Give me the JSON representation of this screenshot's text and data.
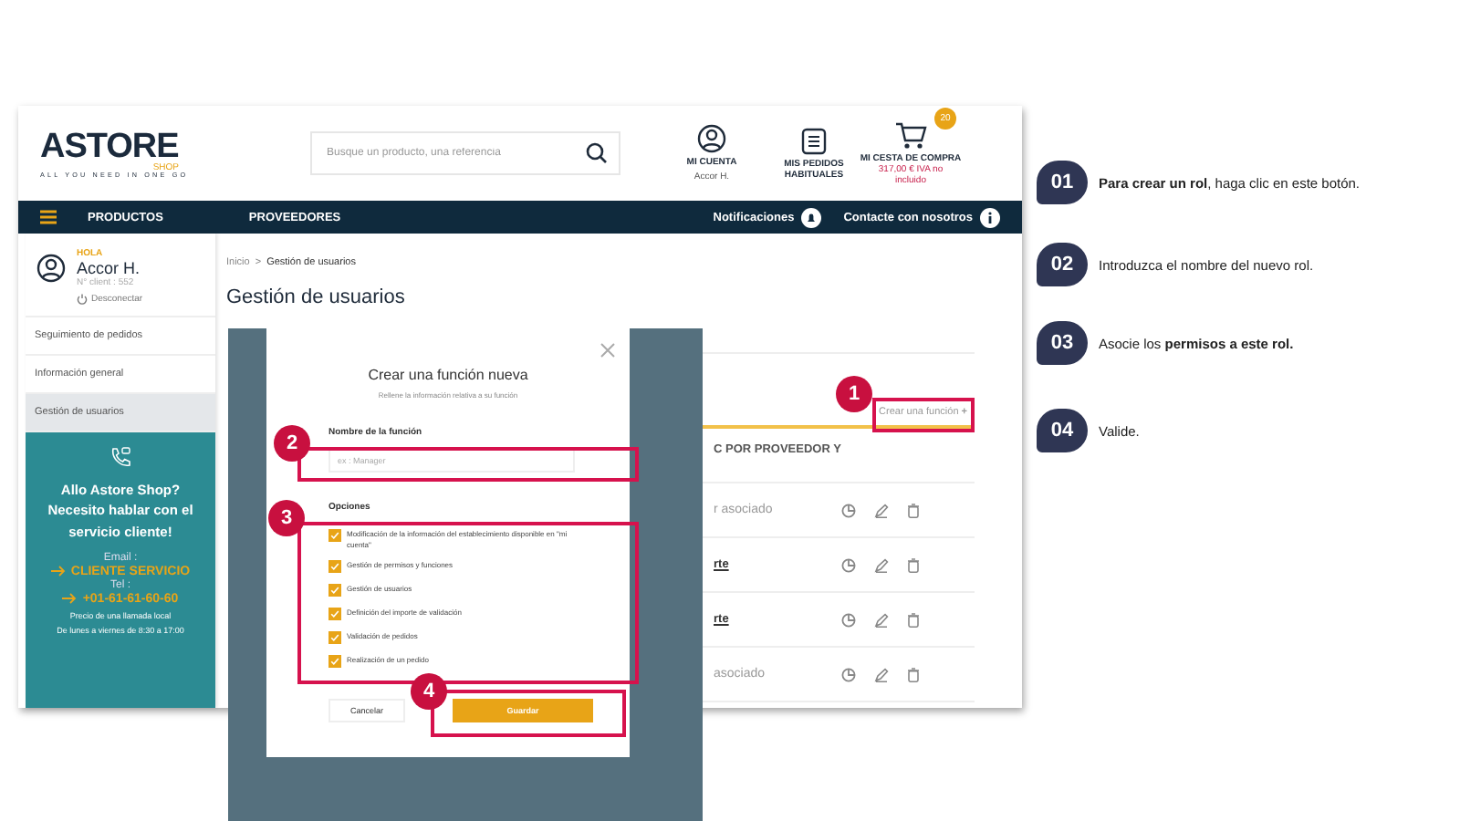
{
  "header": {
    "logo_main": "ASTORE",
    "logo_sub": "SHOP",
    "tagline": "ALL YOU NEED IN ONE GO",
    "search": {
      "placeholder": "Busque un producto, una referencia"
    },
    "account": {
      "label": "MI CUENTA",
      "user": "Accor H."
    },
    "orders": {
      "label": "MIS PEDIDOS HABITUALES"
    },
    "cart": {
      "label": "MI CESTA DE COMPRA",
      "badge": "20",
      "total": "317,00 € IVA no incluido"
    }
  },
  "nav": {
    "items": [
      "PRODUCTOS",
      "PROVEEDORES"
    ],
    "notifications": "Notificaciones",
    "contact": "Contacte con nosotros"
  },
  "sidebar": {
    "greeting": "HOLA",
    "name": "Accor H.",
    "client": "N° client : 552",
    "logout": "Desconectar",
    "items": [
      {
        "label": "Seguimiento de pedidos",
        "selected": false
      },
      {
        "label": "Información general",
        "selected": false
      },
      {
        "label": "Gestión de usuarios",
        "selected": true
      }
    ],
    "help": {
      "title": "Allo Astore Shop? Necesito hablar con el servicio cliente!",
      "email_label": "Email :",
      "email": "CLIENTE SERVICIO",
      "tel_label": "Tel :",
      "tel": "+01-61-61-60-60",
      "note": "Precio de una llamada local",
      "hours": "De lunes a viernes de 8:30 a 17:00"
    }
  },
  "breadcrumb": {
    "items": [
      "Inicio",
      "Gestión de usuarios"
    ],
    "separator": ">"
  },
  "page_title": "Gestión de usuarios",
  "roles": {
    "create_link": "Crear una función",
    "create_plus": "+",
    "header": "C POR PROVEEDOR Y",
    "rows": [
      {
        "text": "r asociado",
        "link": false
      },
      {
        "text": "rte",
        "link": true
      },
      {
        "text": "rte",
        "link": true
      },
      {
        "text": "asociado",
        "link": false
      }
    ]
  },
  "modal": {
    "title": "Crear una función nueva",
    "subtitle": "Rellene la información relativa a su función",
    "name_label": "Nombre de la función",
    "name_placeholder": "ex : Manager",
    "options_label": "Opciones",
    "options": [
      {
        "label": "Modificación de la información del establecimiento disponible en \"mi cuenta\"",
        "checked": true
      },
      {
        "label": "Gestión de permisos y funciones",
        "checked": true
      },
      {
        "label": "Gestión de usuarios",
        "checked": true
      },
      {
        "label": "Definición del importe de validación",
        "checked": true
      },
      {
        "label": "Validación de pedidos",
        "checked": true
      },
      {
        "label": "Realización de un pedido",
        "checked": true
      }
    ],
    "cancel": "Cancelar",
    "save": "Guardar"
  },
  "markers": [
    {
      "number": "1"
    },
    {
      "number": "2"
    },
    {
      "number": "3"
    },
    {
      "number": "4"
    }
  ],
  "steps": [
    {
      "number": "01",
      "text": "**Para crear un rol**, haga clic en este botón."
    },
    {
      "number": "02",
      "text": "Introduzca el nombre del nuevo rol."
    },
    {
      "number": "03",
      "text": "Asocie los **permisos a este rol.**"
    },
    {
      "number": "04",
      "text": "Valide."
    }
  ]
}
